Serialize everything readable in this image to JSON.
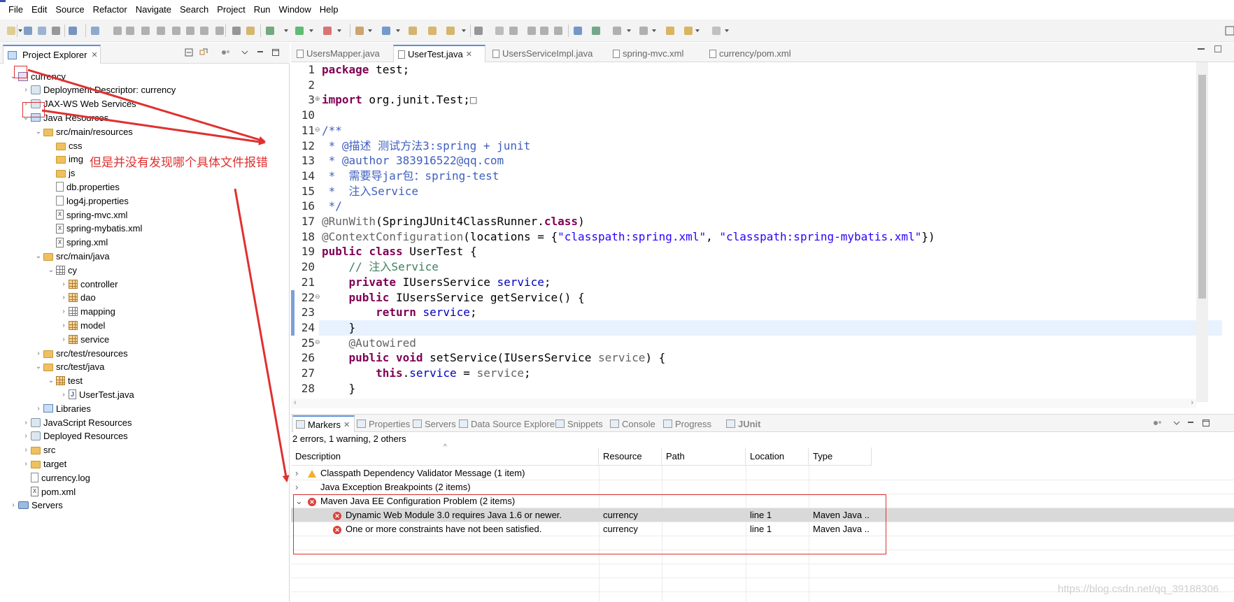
{
  "menu": [
    "File",
    "Edit",
    "Source",
    "Refactor",
    "Navigate",
    "Search",
    "Project",
    "Run",
    "Window",
    "Help"
  ],
  "explorer": {
    "title": "Project Explorer",
    "tree": [
      {
        "label": "currency",
        "level": 0,
        "icon": "project-icon",
        "expanded": true
      },
      {
        "label": "Deployment Descriptor: currency",
        "level": 1,
        "icon": "descriptor-icon",
        "expanded": false
      },
      {
        "label": "JAX-WS Web Services",
        "level": 1,
        "icon": "webservices-icon",
        "expanded": false
      },
      {
        "label": "Java Resources",
        "level": 1,
        "icon": "java-resources-icon",
        "expanded": true
      },
      {
        "label": "src/main/resources",
        "level": 2,
        "icon": "source-folder-icon",
        "expanded": true
      },
      {
        "label": "css",
        "level": 3,
        "icon": "folder-icon"
      },
      {
        "label": "img",
        "level": 3,
        "icon": "folder-icon"
      },
      {
        "label": "js",
        "level": 3,
        "icon": "folder-icon"
      },
      {
        "label": "db.properties",
        "level": 3,
        "icon": "file-icon"
      },
      {
        "label": "log4j.properties",
        "level": 3,
        "icon": "file-icon"
      },
      {
        "label": "spring-mvc.xml",
        "level": 3,
        "icon": "xml-file-icon"
      },
      {
        "label": "spring-mybatis.xml",
        "level": 3,
        "icon": "xml-file-icon"
      },
      {
        "label": "spring.xml",
        "level": 3,
        "icon": "xml-file-icon"
      },
      {
        "label": "src/main/java",
        "level": 2,
        "icon": "source-folder-icon",
        "expanded": true
      },
      {
        "label": "cy",
        "level": 3,
        "icon": "empty-package-icon",
        "expanded": true
      },
      {
        "label": "controller",
        "level": 4,
        "icon": "package-icon",
        "expanded": false
      },
      {
        "label": "dao",
        "level": 4,
        "icon": "package-icon",
        "expanded": false
      },
      {
        "label": "mapping",
        "level": 4,
        "icon": "empty-package-icon",
        "expanded": false
      },
      {
        "label": "model",
        "level": 4,
        "icon": "package-icon",
        "expanded": false
      },
      {
        "label": "service",
        "level": 4,
        "icon": "package-icon",
        "expanded": false
      },
      {
        "label": "src/test/resources",
        "level": 2,
        "icon": "source-folder-icon",
        "expanded": false
      },
      {
        "label": "src/test/java",
        "level": 2,
        "icon": "source-folder-icon",
        "expanded": true
      },
      {
        "label": "test",
        "level": 3,
        "icon": "package-icon",
        "expanded": true
      },
      {
        "label": "UserTest.java",
        "level": 4,
        "icon": "java-file-icon",
        "expanded": false
      },
      {
        "label": "Libraries",
        "level": 2,
        "icon": "library-icon",
        "expanded": false
      },
      {
        "label": "JavaScript Resources",
        "level": 1,
        "icon": "js-resources-icon",
        "expanded": false
      },
      {
        "label": "Deployed Resources",
        "level": 1,
        "icon": "deployed-icon",
        "expanded": false
      },
      {
        "label": "src",
        "level": 1,
        "icon": "folder-icon",
        "expanded": false
      },
      {
        "label": "target",
        "level": 1,
        "icon": "folder-icon",
        "expanded": false
      },
      {
        "label": "currency.log",
        "level": 1,
        "icon": "file-icon"
      },
      {
        "label": "pom.xml",
        "level": 1,
        "icon": "pom-file-icon"
      },
      {
        "label": "Servers",
        "level": 0,
        "icon": "servers-icon",
        "expanded": false
      }
    ]
  },
  "editor_tabs": [
    {
      "label": "UsersMapper.java",
      "active": false
    },
    {
      "label": "UserTest.java",
      "active": true
    },
    {
      "label": "UsersServiceImpl.java",
      "active": false
    },
    {
      "label": "spring-mvc.xml",
      "active": false
    },
    {
      "label": "currency/pom.xml",
      "active": false
    }
  ],
  "code": {
    "line_numbers": [
      "1",
      "2",
      "3",
      "10",
      "11",
      "12",
      "13",
      "14",
      "15",
      "16",
      "17",
      "18",
      "19",
      "20",
      "21",
      "22",
      "23",
      "24",
      "25",
      "26",
      "27",
      "28"
    ],
    "lines": [
      [
        {
          "t": "package",
          "c": "kw"
        },
        {
          "t": " test;",
          "c": ""
        }
      ],
      [],
      [
        {
          "t": "import",
          "c": "kw"
        },
        {
          "t": " org.junit.Test;",
          "c": ""
        },
        {
          "t": "□",
          "c": "an"
        }
      ],
      [],
      [
        {
          "t": "/**",
          "c": "jd"
        }
      ],
      [
        {
          "t": " * ",
          "c": "jd"
        },
        {
          "t": "@描述",
          "c": "jd"
        },
        {
          "t": " 测试方法3:spring + junit",
          "c": "jd"
        }
      ],
      [
        {
          "t": " * ",
          "c": "jd"
        },
        {
          "t": "@author",
          "c": "jd"
        },
        {
          "t": " 383916522@qq.com",
          "c": "jd"
        }
      ],
      [
        {
          "t": " *  需要导jar包：spring-test",
          "c": "jd"
        }
      ],
      [
        {
          "t": " *  注入Service",
          "c": "jd"
        }
      ],
      [
        {
          "t": " */",
          "c": "jd"
        }
      ],
      [
        {
          "t": "@RunWith",
          "c": "an"
        },
        {
          "t": "(SpringJUnit4ClassRunner.",
          "c": ""
        },
        {
          "t": "class",
          "c": "kw"
        },
        {
          "t": ")",
          "c": ""
        }
      ],
      [
        {
          "t": "@ContextConfiguration",
          "c": "an"
        },
        {
          "t": "(locations = {",
          "c": ""
        },
        {
          "t": "\"classpath:spring.xml\"",
          "c": "st"
        },
        {
          "t": ", ",
          "c": ""
        },
        {
          "t": "\"classpath:spring-mybatis.xml\"",
          "c": "st"
        },
        {
          "t": "})",
          "c": ""
        }
      ],
      [
        {
          "t": "public",
          "c": "kw"
        },
        {
          "t": " ",
          "c": ""
        },
        {
          "t": "class",
          "c": "kw"
        },
        {
          "t": " UserTest {",
          "c": ""
        }
      ],
      [
        {
          "t": "    // 注入Service",
          "c": "cm"
        }
      ],
      [
        {
          "t": "    ",
          "c": ""
        },
        {
          "t": "private",
          "c": "kw"
        },
        {
          "t": " IUsersService ",
          "c": ""
        },
        {
          "t": "service",
          "c": "fd"
        },
        {
          "t": ";",
          "c": ""
        }
      ],
      [
        {
          "t": "    ",
          "c": ""
        },
        {
          "t": "public",
          "c": "kw"
        },
        {
          "t": " IUsersService getService() {",
          "c": ""
        }
      ],
      [
        {
          "t": "        ",
          "c": ""
        },
        {
          "t": "return",
          "c": "kw"
        },
        {
          "t": " ",
          "c": ""
        },
        {
          "t": "service",
          "c": "fd"
        },
        {
          "t": ";",
          "c": ""
        }
      ],
      [
        {
          "t": "    }",
          "c": ""
        }
      ],
      [
        {
          "t": "    ",
          "c": ""
        },
        {
          "t": "@Autowired",
          "c": "an"
        }
      ],
      [
        {
          "t": "    ",
          "c": ""
        },
        {
          "t": "public",
          "c": "kw"
        },
        {
          "t": " ",
          "c": ""
        },
        {
          "t": "void",
          "c": "kw"
        },
        {
          "t": " setService(IUsersService ",
          "c": ""
        },
        {
          "t": "service",
          "c": "an"
        },
        {
          "t": ") {",
          "c": ""
        }
      ],
      [
        {
          "t": "        ",
          "c": ""
        },
        {
          "t": "this",
          "c": "kw"
        },
        {
          "t": ".",
          "c": ""
        },
        {
          "t": "service",
          "c": "fd"
        },
        {
          "t": " = ",
          "c": ""
        },
        {
          "t": "service",
          "c": "an"
        },
        {
          "t": ";",
          "c": ""
        }
      ],
      [
        {
          "t": "    }",
          "c": ""
        }
      ]
    ]
  },
  "bottom_tabs": [
    {
      "label": "Markers",
      "active": true
    },
    {
      "label": "Properties",
      "active": false
    },
    {
      "label": "Servers",
      "active": false
    },
    {
      "label": "Data Source Explorer",
      "active": false
    },
    {
      "label": "Snippets",
      "active": false
    },
    {
      "label": "Console",
      "active": false
    },
    {
      "label": "Progress",
      "active": false
    },
    {
      "label": "JUnit",
      "active": false
    }
  ],
  "markers": {
    "summary": "2 errors, 1 warning, 2 others",
    "columns": [
      "Description",
      "Resource",
      "Path",
      "Location",
      "Type"
    ],
    "rows": [
      {
        "kind": "group",
        "icon": "warning-icon",
        "description": "Classpath Dependency Validator Message (1 item)",
        "resource": "",
        "path": "",
        "location": "",
        "type": ""
      },
      {
        "kind": "group",
        "icon": "",
        "description": "Java Exception Breakpoints (2 items)",
        "resource": "",
        "path": "",
        "location": "",
        "type": ""
      },
      {
        "kind": "group-open",
        "icon": "error-icon",
        "description": "Maven Java EE Configuration Problem (2 items)",
        "resource": "",
        "path": "",
        "location": "",
        "type": ""
      },
      {
        "kind": "child-selected",
        "icon": "error-icon",
        "description": "Dynamic Web Module 3.0 requires Java 1.6 or newer.",
        "resource": "currency",
        "path": "",
        "location": "line 1",
        "type": "Maven Java ..."
      },
      {
        "kind": "child",
        "icon": "error-icon",
        "description": "One or more constraints have not been satisfied.",
        "resource": "currency",
        "path": "",
        "location": "line 1",
        "type": "Maven Java ..."
      }
    ]
  },
  "annotation": "但是并没有发现哪个具体文件报错",
  "watermark": "https://blog.csdn.net/qq_39188306",
  "colors": {
    "annotation_red": "#e03030",
    "active_tab_border": "#5b8fd4",
    "selected_row": "#d9d9d9"
  }
}
